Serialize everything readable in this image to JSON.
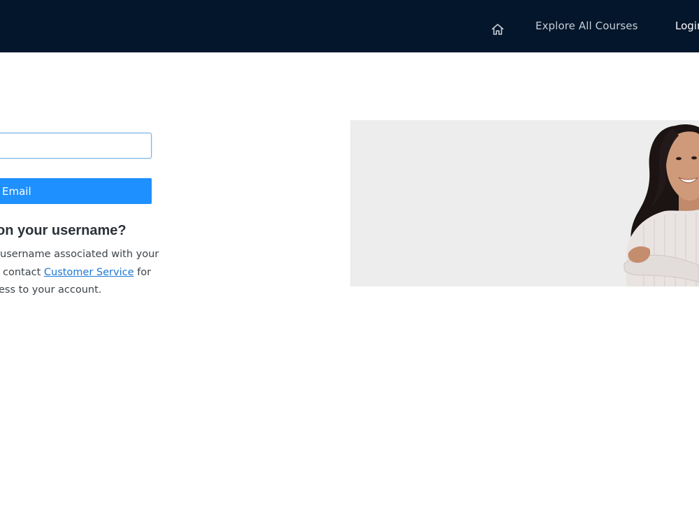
{
  "nav": {
    "home_icon": "home-icon",
    "explore_label": "Explore All Courses",
    "login_label": "Login"
  },
  "form": {
    "email_value": "",
    "submit_label": "Email"
  },
  "help": {
    "heading": "on your username?",
    "line1": "username associated with your",
    "line2_prefix": "contact",
    "link_label": "Customer Service",
    "line2_suffix": "for",
    "line3": "ess to your account."
  },
  "hero": {
    "image_subject": "smiling woman with arms crossed"
  },
  "colors": {
    "nav_bg": "#03162b",
    "button_bg": "#1e90ff",
    "link": "#1e78d6",
    "hero_bg": "#ededed"
  }
}
